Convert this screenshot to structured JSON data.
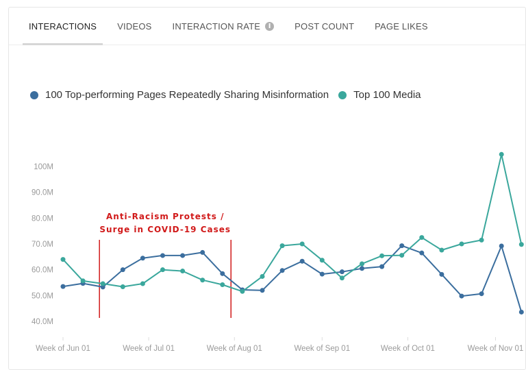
{
  "tabs": [
    {
      "label": "INTERACTIONS",
      "active": true
    },
    {
      "label": "VIDEOS",
      "active": false
    },
    {
      "label": "INTERACTION RATE",
      "active": false,
      "icon": "info-icon"
    },
    {
      "label": "POST COUNT",
      "active": false
    },
    {
      "label": "PAGE LIKES",
      "active": false
    }
  ],
  "info_icon_glyph": "i",
  "chart_data": {
    "type": "line",
    "title": "",
    "xlabel": "",
    "ylabel": "",
    "ylim": [
      40,
      104
    ],
    "y_ticks": [
      "40.0M",
      "50.0M",
      "60.0M",
      "70.0M",
      "80.0M",
      "90.0M",
      "100M"
    ],
    "y_tick_values": [
      40,
      50,
      60,
      70,
      80,
      90,
      100
    ],
    "x_tick_labels": [
      "Week of Jun 01",
      "Week of Jul 01",
      "Week of Aug 01",
      "Week of Sep 01",
      "Week of Oct 01",
      "Week of Nov 01"
    ],
    "x_tick_index": [
      0,
      4.3,
      8.6,
      13,
      17.3,
      21.7
    ],
    "grid": false,
    "legend_placement": "top-left",
    "series": [
      {
        "name": "100 Top-performing Pages Repeatedly Sharing Misinformation",
        "color": "#3b6e9e",
        "values": [
          53.5,
          54.7,
          53.3,
          60.0,
          64.5,
          65.5,
          65.5,
          66.7,
          58.5,
          52.2,
          52.0,
          59.7,
          63.3,
          58.3,
          59.2,
          60.5,
          61.2,
          69.3,
          66.5,
          58.2,
          49.8,
          50.7,
          69.2,
          43.6
        ]
      },
      {
        "name": "Top 100 Media",
        "color": "#3aa79c",
        "values": [
          64.0,
          55.7,
          54.6,
          53.4,
          54.6,
          60.0,
          59.5,
          56.0,
          54.2,
          51.6,
          57.4,
          69.3,
          70.0,
          63.7,
          56.8,
          62.3,
          65.4,
          65.6,
          72.5,
          67.6,
          70.0,
          71.5,
          104.7,
          69.8
        ]
      }
    ],
    "annotations": [
      {
        "text_lines": [
          "Anti-Racism Protests /",
          "Surge in COVID-19 Cases"
        ],
        "color": "#d11a1a",
        "markers_at_index": [
          2,
          8.6
        ]
      }
    ]
  }
}
